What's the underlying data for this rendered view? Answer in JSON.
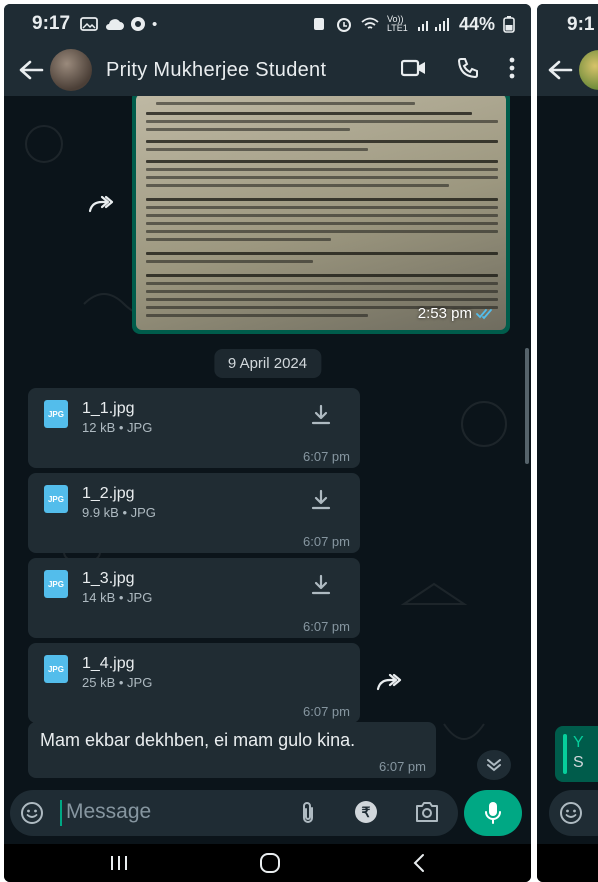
{
  "status_bar": {
    "time": "9:17",
    "signal_text": "Vo)) LTE1",
    "battery": "44%"
  },
  "app_bar": {
    "contact_name": "Prity Mukherjee Student"
  },
  "messages": {
    "image_message": {
      "time": "2:53 pm",
      "read_receipt": "double-check-icon"
    },
    "date_chip": "9 April 2024",
    "documents": [
      {
        "name": "1_1.jpg",
        "meta": "12 kB • JPG",
        "time": "6:07 pm"
      },
      {
        "name": "1_2.jpg",
        "meta": "9.9 kB • JPG",
        "time": "6:07 pm"
      },
      {
        "name": "1_3.jpg",
        "meta": "14 kB • JPG",
        "time": "6:07 pm"
      },
      {
        "name": "1_4.jpg",
        "meta": "25 kB • JPG",
        "time": "6:07 pm"
      }
    ],
    "text_message": {
      "body": "Mam ekbar dekhben, ei mam gulo kina.",
      "time": "6:07 pm"
    },
    "file_badge": "JPG"
  },
  "input_bar": {
    "placeholder": "Message",
    "rupee_symbol": "₹"
  },
  "second_phone": {
    "time": "9:1",
    "bubble_line1": "Y",
    "bubble_line2": "S"
  },
  "colors": {
    "background": "#0b141a",
    "bar": "#1f2c34",
    "incoming_bubble": "#202c33",
    "outgoing_bubble": "#005c4b",
    "accent": "#00a884"
  }
}
